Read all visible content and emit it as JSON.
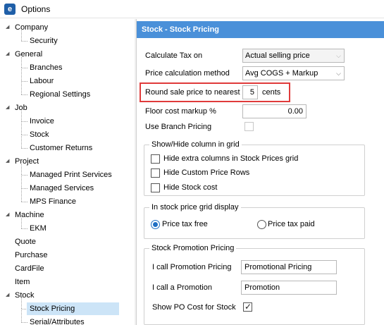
{
  "window": {
    "title": "Options",
    "icon": "app-logo-icon"
  },
  "tree": {
    "nodes": [
      {
        "label": "Company",
        "level": 0,
        "expanded": true
      },
      {
        "label": "Security",
        "level": 1
      },
      {
        "label": "General",
        "level": 0,
        "expanded": true
      },
      {
        "label": "Branches",
        "level": 1
      },
      {
        "label": "Labour",
        "level": 1
      },
      {
        "label": "Regional Settings",
        "level": 1
      },
      {
        "label": "Job",
        "level": 0,
        "expanded": true
      },
      {
        "label": "Invoice",
        "level": 1
      },
      {
        "label": "Stock",
        "level": 1
      },
      {
        "label": "Customer Returns",
        "level": 1
      },
      {
        "label": "Project",
        "level": 0,
        "expanded": true
      },
      {
        "label": "Managed Print Services",
        "level": 1
      },
      {
        "label": "Managed Services",
        "level": 1
      },
      {
        "label": "MPS Finance",
        "level": 1
      },
      {
        "label": "Machine",
        "level": 0,
        "expanded": true
      },
      {
        "label": "EKM",
        "level": 1
      },
      {
        "label": "Quote",
        "level": 0
      },
      {
        "label": "Purchase",
        "level": 0
      },
      {
        "label": "CardFile",
        "level": 0
      },
      {
        "label": "Item",
        "level": 0
      },
      {
        "label": "Stock",
        "level": 0,
        "expanded": true
      },
      {
        "label": "Stock Pricing",
        "level": 1,
        "selected": true
      },
      {
        "label": "Serial/Attributes",
        "level": 1
      }
    ]
  },
  "panel": {
    "header": "Stock - Stock Pricing",
    "calc_tax": {
      "label": "Calculate Tax on",
      "value": "Actual selling price"
    },
    "price_method": {
      "label": "Price calculation method",
      "value": "Avg COGS + Markup"
    },
    "round_price": {
      "label": "Round sale price to nearest",
      "value": "5",
      "unit": "cents"
    },
    "floor_markup": {
      "label": "Floor cost markup %",
      "value": "0.00"
    },
    "branch_pricing": {
      "label": "Use Branch Pricing",
      "checked": false
    },
    "show_hide_group": {
      "title": "Show/Hide column in grid",
      "options": [
        {
          "label": "Hide extra columns in Stock Prices grid",
          "checked": false
        },
        {
          "label": "Hide Custom Price Rows",
          "checked": false
        },
        {
          "label": "Hide Stock cost",
          "checked": false
        }
      ]
    },
    "grid_display_group": {
      "title": "In stock price grid display",
      "options": [
        {
          "label": "Price tax free",
          "selected": true
        },
        {
          "label": "Price tax paid",
          "selected": false
        }
      ]
    },
    "promo_group": {
      "title": "Stock Promotion Pricing",
      "promo_pricing": {
        "label": "I call Promotion Pricing",
        "value": "Promotional Pricing"
      },
      "promotion": {
        "label": "I call a Promotion",
        "value": "Promotion"
      },
      "show_po_cost": {
        "label": "Show PO Cost for Stock",
        "checked": true
      }
    }
  },
  "colors": {
    "header_bg": "#4a90d9",
    "highlight": "#e03b3b",
    "selected_bg": "#cce4f7"
  }
}
